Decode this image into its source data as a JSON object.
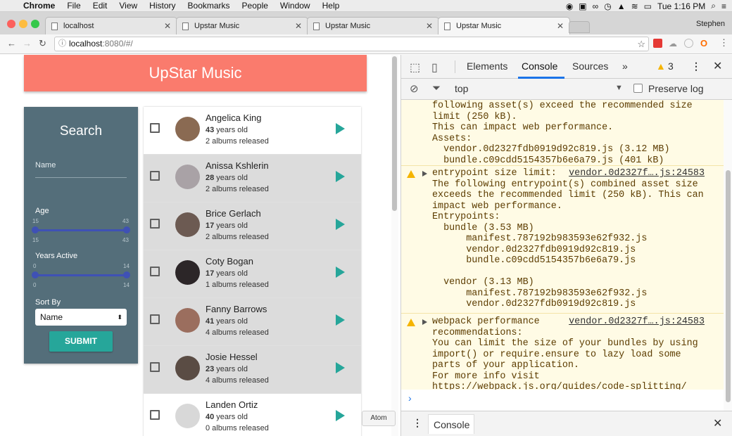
{
  "menubar": {
    "items": [
      "Chrome",
      "File",
      "Edit",
      "View",
      "History",
      "Bookmarks",
      "People",
      "Window",
      "Help"
    ],
    "clock": "Tue 1:16 PM"
  },
  "tabs": [
    {
      "label": "localhost",
      "active": false
    },
    {
      "label": "Upstar Music",
      "active": false
    },
    {
      "label": "Upstar Music",
      "active": false
    },
    {
      "label": "Upstar Music",
      "active": true
    }
  ],
  "profile": "Stephen",
  "address": {
    "host": "localhost",
    "rest": ":8080/#/"
  },
  "app": {
    "title": "UpStar Music",
    "search": {
      "title": "Search",
      "name_placeholder": "Name",
      "age_label": "Age",
      "age_min": "15",
      "age_max": "43",
      "years_label": "Years Active",
      "years_min": "0",
      "years_max": "14",
      "sort_label": "Sort By",
      "sort_value": "Name",
      "submit": "SUBMIT"
    },
    "artists": [
      {
        "name": "Angelica King",
        "age": "43",
        "age_suffix": " years old",
        "albums": "2 albums released"
      },
      {
        "name": "Anissa Kshlerin",
        "age": "28",
        "age_suffix": " years old",
        "albums": "2 albums released"
      },
      {
        "name": "Brice Gerlach",
        "age": "17",
        "age_suffix": " years old",
        "albums": "2 albums released"
      },
      {
        "name": "Coty Bogan",
        "age": "17",
        "age_suffix": " years old",
        "albums": "1 albums released"
      },
      {
        "name": "Fanny Barrows",
        "age": "41",
        "age_suffix": " years old",
        "albums": "4 albums released"
      },
      {
        "name": "Josie Hessel",
        "age": "23",
        "age_suffix": " years old",
        "albums": "4 albums released"
      },
      {
        "name": "Landen Ortiz",
        "age": "40",
        "age_suffix": " years old",
        "albums": "0 albums released"
      }
    ],
    "tooltip": "Atom"
  },
  "devtools": {
    "tabs": [
      "Elements",
      "Console",
      "Sources",
      "»"
    ],
    "warning_count": "3",
    "context": "top",
    "preserve_log": "Preserve log",
    "messages": [
      {
        "lines": [
          "following asset(s) exceed the recommended size",
          "limit (250 kB).",
          "This can impact web performance.",
          "Assets:",
          "  vendor.0d2327fdb0919d92c819.js (3.12 MB)",
          "  bundle.c09cdd5154357b6e6a79.js (401 kB)"
        ]
      },
      {
        "title": "entrypoint size limit:",
        "source": "vendor.0d2327f….js:24583",
        "lines": [
          "The following entrypoint(s) combined asset size",
          "exceeds the recommended limit (250 kB). This can",
          "impact web performance.",
          "Entrypoints:",
          "  bundle (3.53 MB)",
          "      manifest.787192b983593e62f932.js",
          "      vendor.0d2327fdb0919d92c819.js",
          "      bundle.c09cdd5154357b6e6a79.js",
          "",
          "  vendor (3.13 MB)",
          "      manifest.787192b983593e62f932.js",
          "      vendor.0d2327fdb0919d92c819.js"
        ]
      },
      {
        "title": "webpack performance",
        "source": "vendor.0d2327f….js:24583",
        "lines": [
          "recommendations:",
          "You can limit the size of your bundles by using",
          "import() or require.ensure to lazy load some",
          "parts of your application.",
          "For more info visit",
          "https://webpack.js.org/guides/code-splitting/"
        ]
      }
    ],
    "prompt": "›",
    "drawer_tab": "Console"
  },
  "colors": {
    "header": "#fa7b6d",
    "sidebar": "#546e7a",
    "accent": "#26a69a",
    "slider": "#3f51b5",
    "warning_bg": "#fffbe5"
  }
}
